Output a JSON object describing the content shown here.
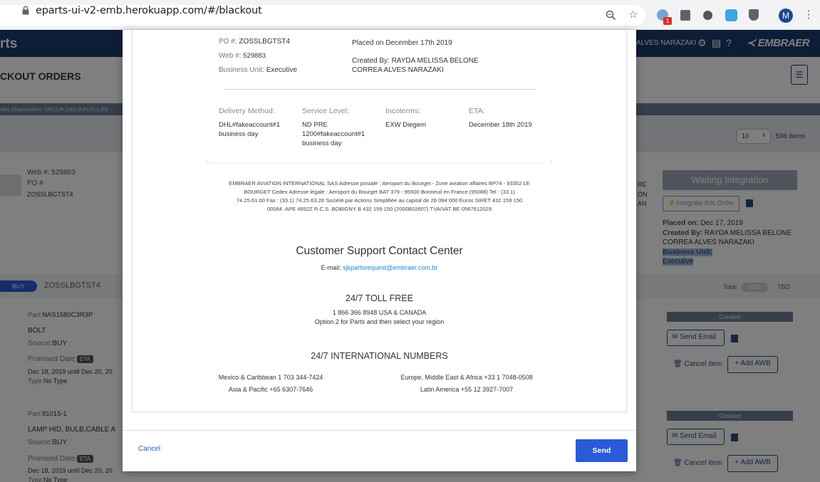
{
  "browser": {
    "url": "eparts-ui-v2-emb.herokuapp.com/#/blackout",
    "badge_count": "1",
    "profile_initial": "M"
  },
  "header": {
    "app_name": "rts",
    "user_name": "ALVES NARAZAKI",
    "logo_text": "EMBRAER"
  },
  "page": {
    "title": "CKOUT ORDERS",
    "sales_org": "ales Organization: SIN,SJK,LBG,BJG,FLL,ES",
    "page_size": "10",
    "items_count": "596 items"
  },
  "order_card": {
    "web_no": "Web #: 529883",
    "po_label": "PO #",
    "po_value": "ZOSSLBGTST4",
    "status_button": "Waiting Integration",
    "integrate_button": "Integrate this Order",
    "placed_label": "Placed on:",
    "placed_value": "Dec 17, 2019",
    "created_label": "Created By:",
    "created_value_1": "RAYDA MELISSA BELONE",
    "created_value_2": "CORREA ALVES NARAZAKI",
    "bu_label": "Business Unit:",
    "bu_value": "Executive",
    "side_text_1": "RE",
    "side_text_2": "ON",
    "side_text_3": "AN",
    "buy_tag": "BUY",
    "po_title": "ZOSSLBGTST4",
    "total_label": "Total",
    "currency": "USD",
    "total_value": "TBD"
  },
  "line_items": [
    {
      "part_label": "Part:",
      "part_value": "NAS1580C3R3P",
      "name": "BOLT",
      "source_label": "Source:",
      "source_value": "BUY",
      "promised_label": "Promised Date:",
      "eta_tag": "ETA",
      "date_range": "Dec 18, 2019 until Dec 20, 20",
      "type_label": "Type:",
      "type_value": "No Type",
      "status": "Created",
      "send_email": "Send Email",
      "cancel_item": "Cancel item",
      "add_awb": "+ Add AWB"
    },
    {
      "part_label": "Part:",
      "part_value": "81015-1",
      "name": "LAMP HID, BULB,CABLE A",
      "source_label": "Source:",
      "source_value": "BUY",
      "promised_label": "Promised Date:",
      "eta_tag": "ETA",
      "date_range": "Dec 18, 2019 until Dec 20, 20",
      "type_label": "Type:",
      "type_value": "No Type",
      "status": "Created",
      "send_email": "Send Email",
      "cancel_item": "Cancel item",
      "add_awb": "+ Add AWB"
    }
  ],
  "modal": {
    "po_label": "PO #:",
    "po_value": "ZOSSLBGTST4",
    "web_label": "Web #:",
    "web_value": "529883",
    "bu_label": "Business Unit:",
    "bu_value": "Executive",
    "placed": "Placed on December 17th 2019",
    "created_1": "Created By: RAYDA MELISSA BELONE",
    "created_2": "CORREA ALVES NARAZAKI",
    "delivery_label": "Delivery Method:",
    "delivery_value_1": "DHL#fakeaccount#1",
    "delivery_value_2": "business day",
    "service_label": "Service Level:",
    "service_value_1": "ND PRE",
    "service_value_2": "1200#fakeaccount#1",
    "service_value_3": "business day",
    "incoterms_label": "Incoterms:",
    "incoterms_value": "EXW Diegem",
    "eta_label": "ETA:",
    "eta_value": "December 18th 2019",
    "legal_1": "EMBRAER AVIATION INTERNATIONAL SAS Adresse postale : Aeroport du Bourget - Zone aviation affaires BP74 - 93352 LE",
    "legal_2": "BOURGET Cedex Adresse légale : Aeroport du Bourget BAT 379 - 95500 Bonneuil en France (95088) Tel : (33.1)",
    "legal_3": "74.25.61.00 Fax : (33.1) 74.25.63.28 Société par Actions Simplifiée au capital de 28 094 000 Euros SIRET 432 159 150",
    "legal_4": "00064. APE 4652Z R.C.S. BOBIGNY B 432 159 150 (2000B02607) TVA/VAT BE 0567612029",
    "support_title": "Customer Support Contact Center",
    "email_label": "E-mail:",
    "email_value": "sjkpartsrequest@embraer.com.br",
    "toll_title": "24/7 TOLL FREE",
    "toll_line_1": "1 866 366 8948 USA & CANADA",
    "toll_line_2": "Option 2 for Parts and then select your region",
    "intl_title": "24/7 INTERNATIONAL NUMBERS",
    "intl_1": "Mexico & Caribbean 1 703 344-7424",
    "intl_2": "Europe, Middle East & Africa +33 1 7048-0508",
    "intl_3": "Asia & Pacific +65 6307-7646",
    "intl_4": "Latin America +55 12 3927-7007",
    "cancel": "Cancel",
    "send": "Send"
  },
  "colors": {
    "header_bg": "#1c3b6f",
    "send_button": "#2a5bd7",
    "link": "#1a8bd1"
  }
}
